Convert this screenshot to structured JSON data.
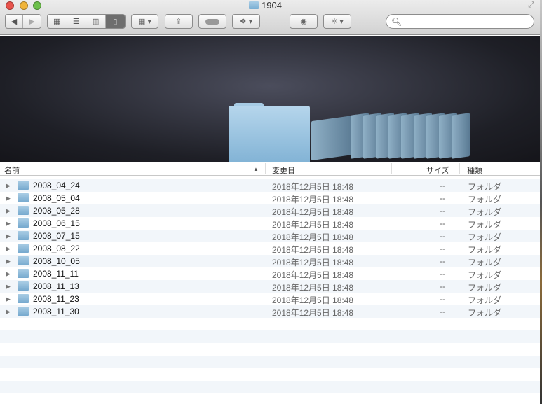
{
  "window": {
    "title": "1904"
  },
  "toolbar": {
    "search_placeholder": ""
  },
  "coverflow": {
    "selected": "2008_04_24"
  },
  "columns": {
    "name": "名前",
    "modified": "変更日",
    "size": "サイズ",
    "kind": "種類"
  },
  "files": [
    {
      "name": "2008_04_24",
      "modified": "2018年12月5日 18:48",
      "size": "--",
      "kind": "フォルダ"
    },
    {
      "name": "2008_05_04",
      "modified": "2018年12月5日 18:48",
      "size": "--",
      "kind": "フォルダ"
    },
    {
      "name": "2008_05_28",
      "modified": "2018年12月5日 18:48",
      "size": "--",
      "kind": "フォルダ"
    },
    {
      "name": "2008_06_15",
      "modified": "2018年12月5日 18:48",
      "size": "--",
      "kind": "フォルダ"
    },
    {
      "name": "2008_07_15",
      "modified": "2018年12月5日 18:48",
      "size": "--",
      "kind": "フォルダ"
    },
    {
      "name": "2008_08_22",
      "modified": "2018年12月5日 18:48",
      "size": "--",
      "kind": "フォルダ"
    },
    {
      "name": "2008_10_05",
      "modified": "2018年12月5日 18:48",
      "size": "--",
      "kind": "フォルダ"
    },
    {
      "name": "2008_11_11",
      "modified": "2018年12月5日 18:48",
      "size": "--",
      "kind": "フォルダ"
    },
    {
      "name": "2008_11_13",
      "modified": "2018年12月5日 18:48",
      "size": "--",
      "kind": "フォルダ"
    },
    {
      "name": "2008_11_23",
      "modified": "2018年12月5日 18:48",
      "size": "--",
      "kind": "フォルダ"
    },
    {
      "name": "2008_11_30",
      "modified": "2018年12月5日 18:48",
      "size": "--",
      "kind": "フォルダ"
    }
  ]
}
